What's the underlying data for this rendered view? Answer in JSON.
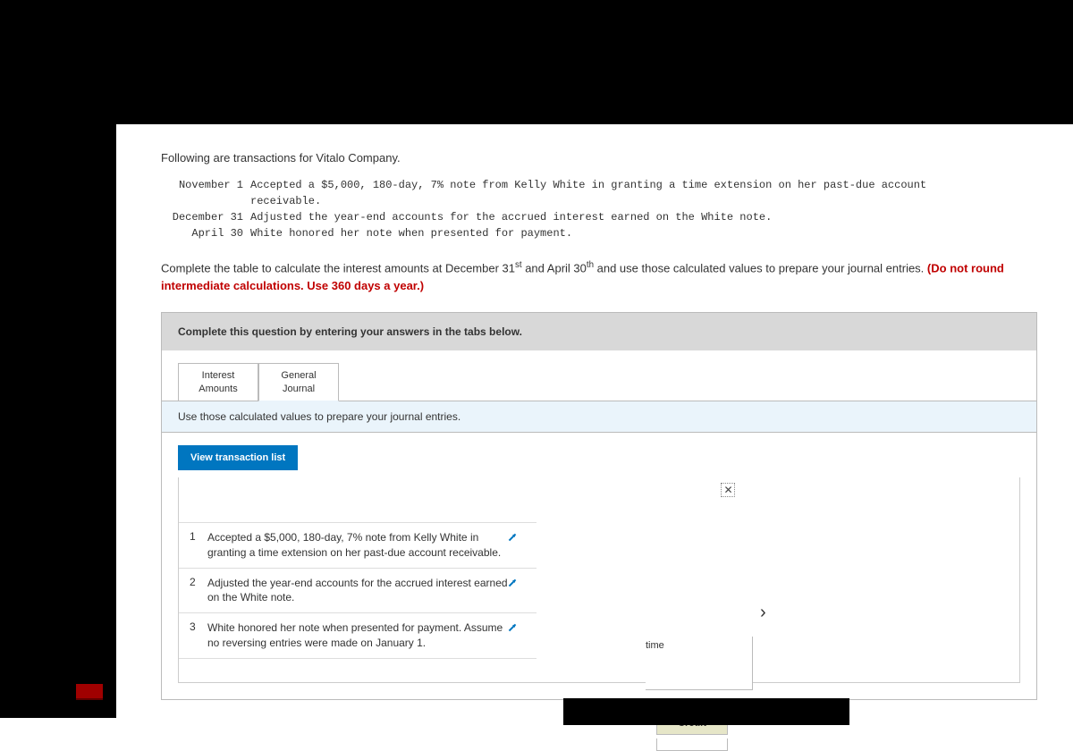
{
  "intro": "Following are transactions for Vitalo Company.",
  "transactions_given": [
    {
      "date": "November 1",
      "desc_line1": "Accepted a $5,000, 180-day, 7% note from Kelly White in granting a time extension on her past-due account",
      "desc_line2": "receivable."
    },
    {
      "date": "December 31",
      "desc_line1": "Adjusted the year-end accounts for the accrued interest earned on the White note.",
      "desc_line2": ""
    },
    {
      "date": "April 30",
      "desc_line1": "White honored her note when presented for payment.",
      "desc_line2": ""
    }
  ],
  "instruction_prefix": "Complete the table to calculate the interest amounts at December 31",
  "instruction_sup1": "st",
  "instruction_mid": " and April 30",
  "instruction_sup2": "th",
  "instruction_suffix": " and use those calculated values to prepare your journal entries. ",
  "instruction_red": "(Do not round intermediate calculations. Use 360 days a year.)",
  "banner": "Complete this question by entering your answers in the tabs below.",
  "tabs": {
    "interest": "Interest Amounts",
    "journal": "General Journal"
  },
  "subinstruction": "Use those calculated values to prepare your journal entries.",
  "view_list_label": "View transaction list",
  "list": [
    {
      "n": "1",
      "text": "Accepted a $5,000, 180-day, 7% note from Kelly White in granting a time extension on her past-due account receivable."
    },
    {
      "n": "2",
      "text": "Adjusted the year-end accounts for the accrued interest earned on the White note."
    },
    {
      "n": "3",
      "text": "White honored her note when presented for payment. Assume no reversing entries were made on January 1."
    }
  ],
  "fragments": {
    "time": "time",
    "credit": "Credit",
    "chevron": "›"
  },
  "close_glyph": "✕"
}
